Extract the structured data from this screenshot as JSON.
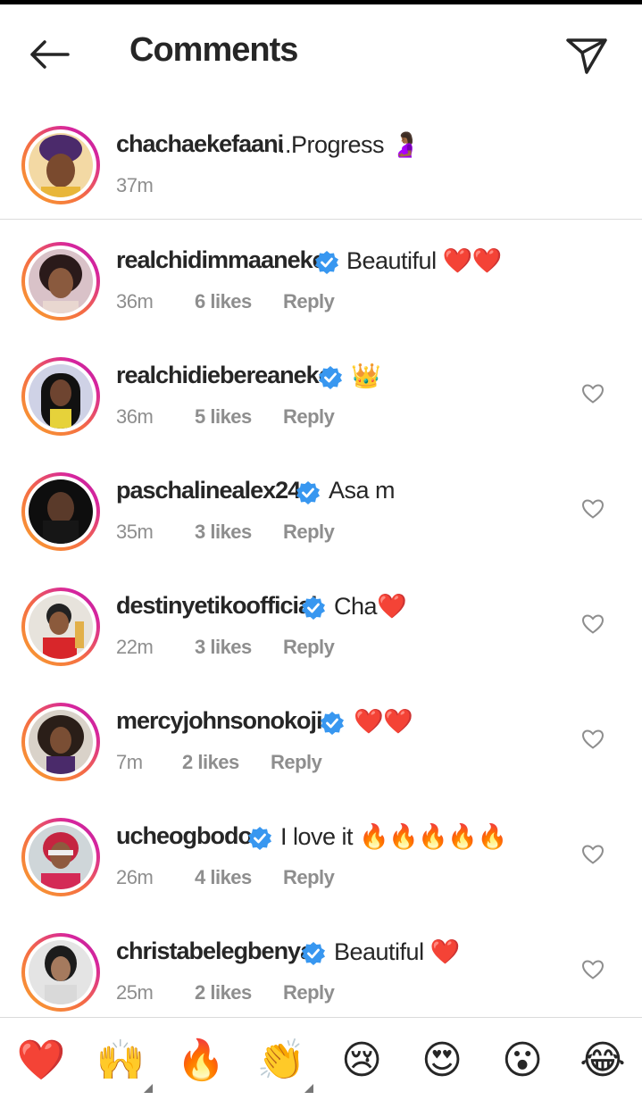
{
  "header": {
    "title": "Comments",
    "back_icon": "arrow-left-icon",
    "share_icon": "paper-plane-icon"
  },
  "caption": {
    "username": "chachaekefaani",
    "text": "...Progress 🤰🏾",
    "time": "37m"
  },
  "comments": [
    {
      "username": "realchidimmaaneke",
      "verified": true,
      "text": "Beautiful ❤️❤️",
      "time": "36m",
      "likes": "6 likes",
      "reply": "Reply",
      "has_like_button": false
    },
    {
      "username": "realchidiebereaneke",
      "verified": true,
      "text": "👑",
      "time": "36m",
      "likes": "5 likes",
      "reply": "Reply",
      "has_like_button": true
    },
    {
      "username": "paschalinealex24",
      "verified": true,
      "text": "Asa m",
      "time": "35m",
      "likes": "3 likes",
      "reply": "Reply",
      "has_like_button": true
    },
    {
      "username": "destinyetikoofficial",
      "verified": true,
      "text": "Cha❤️",
      "time": "22m",
      "likes": "3 likes",
      "reply": "Reply",
      "has_like_button": true
    },
    {
      "username": "mercyjohnsonokojie",
      "verified": true,
      "text": "❤️❤️",
      "time": "7m",
      "likes": "2 likes",
      "reply": "Reply",
      "has_like_button": true
    },
    {
      "username": "ucheogbodo",
      "verified": true,
      "text": "I love it 🔥🔥🔥🔥🔥",
      "time": "26m",
      "likes": "4 likes",
      "reply": "Reply",
      "has_like_button": true
    },
    {
      "username": "christabelegbenya",
      "verified": true,
      "text": "Beautiful ❤️",
      "time": "25m",
      "likes": "2 likes",
      "reply": "Reply",
      "has_like_button": true
    }
  ],
  "reactions": [
    "❤️",
    "🙌",
    "🔥",
    "👏",
    "😢",
    "😍",
    "😮",
    "😂"
  ],
  "colors": {
    "verified": "#3897f0",
    "text": "#262626",
    "meta": "#8e8e8e",
    "divider": "#dbdbdb"
  }
}
